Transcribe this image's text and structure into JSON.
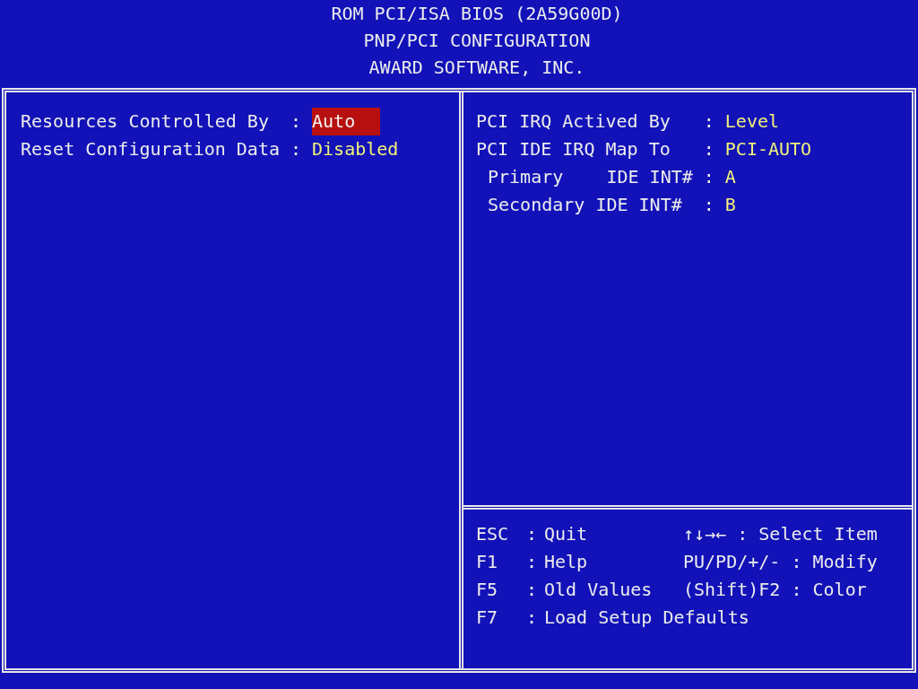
{
  "header": {
    "lines": [
      "ROM PCI/ISA BIOS (2A59G00D)",
      "PNP/PCI CONFIGURATION",
      "AWARD SOFTWARE, INC."
    ]
  },
  "left_settings": [
    {
      "label": "Resources Controlled By",
      "separator": ":",
      "value": "Auto",
      "selected": true
    },
    {
      "label": "Reset Configuration Data",
      "separator": ":",
      "value": "Disabled",
      "selected": false
    }
  ],
  "right_settings": [
    {
      "indented": false,
      "label": "PCI IRQ Actived By",
      "separator": ":",
      "value": "Level",
      "selected": false
    },
    {
      "indented": false,
      "label": "PCI IDE IRQ Map To",
      "separator": ":",
      "value": "PCI-AUTO",
      "selected": false
    },
    {
      "indented": true,
      "label": "Primary    IDE INT#",
      "separator": ":",
      "value": "A",
      "selected": false
    },
    {
      "indented": true,
      "label": "Secondary IDE INT#",
      "separator": ":",
      "value": "B",
      "selected": false
    }
  ],
  "help": {
    "left": [
      {
        "key": "ESC",
        "separator": ":",
        "action": "Quit"
      },
      {
        "key": "F1",
        "separator": ":",
        "action": "Help"
      },
      {
        "key": "F5",
        "separator": ":",
        "action": "Old Values"
      },
      {
        "key": "F7",
        "separator": ":",
        "action": "Load Setup Defaults"
      }
    ],
    "right": [
      {
        "key": "↑↓→←",
        "separator": ":",
        "action": "Select Item"
      },
      {
        "key": "PU/PD/+/-",
        "separator": ":",
        "action": "Modify"
      },
      {
        "key": "(Shift)F2",
        "separator": ":",
        "action": "Color"
      }
    ]
  }
}
